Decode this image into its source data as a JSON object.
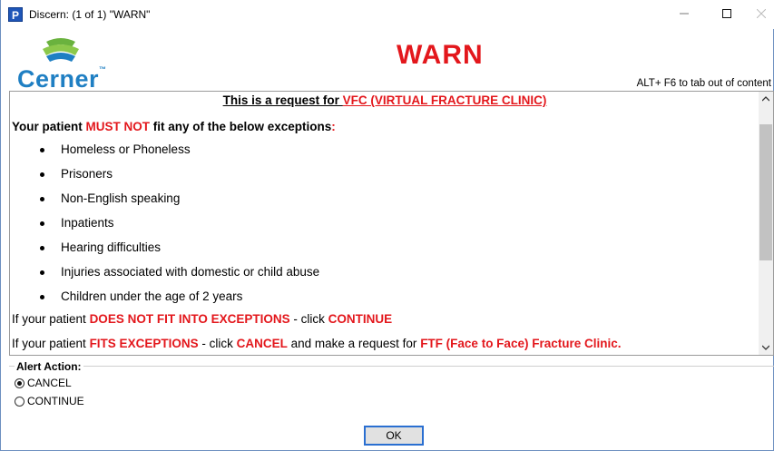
{
  "window": {
    "title": "Discern: (1 of 1) \"WARN\"",
    "app_icon_letter": "P",
    "controls": {
      "minimize": "minimize-icon",
      "maximize": "maximize-icon",
      "close": "close-icon"
    }
  },
  "header": {
    "logo_text": "Cerner",
    "logo_tm": "™",
    "title": "WARN",
    "alt_hint": "ALT+ F6 to tab out of content"
  },
  "message": {
    "heading_prefix": "This is a request for ",
    "heading_highlight": "VFC (VIRTUAL FRACTURE CLINIC)",
    "exceptions_intro_1": "Your patient ",
    "exceptions_intro_2": "MUST NOT",
    "exceptions_intro_3": " fit any of the below exceptions",
    "exceptions_intro_4": ":",
    "exceptions": [
      "Homeless or Phoneless",
      "Prisoners",
      "Non-English speaking",
      "Inpatients",
      "Hearing difficulties",
      "Injuries associated with domestic or child abuse",
      "Children under the age of 2 years"
    ],
    "continue_line_1": "If your patient ",
    "continue_line_2": "DOES NOT FIT INTO EXCEPTIONS",
    "continue_line_3": " - click ",
    "continue_line_4": "CONTINUE",
    "cancel_line_1": "If your patient ",
    "cancel_line_2": "FITS EXCEPTIONS",
    "cancel_line_3": " - click ",
    "cancel_line_4": "CANCEL",
    "cancel_line_5": " and make a request for ",
    "cancel_line_6": "FTF (Face to Face) Fracture Clinic."
  },
  "alert_action": {
    "label": "Alert Action:",
    "options": [
      {
        "label": "CANCEL",
        "selected": true
      },
      {
        "label": "CONTINUE",
        "selected": false
      }
    ]
  },
  "ok_button": "OK",
  "colors": {
    "warn_red": "#e3171c",
    "cerner_blue": "#1f7fc3",
    "logo_green": "#6ab23e"
  }
}
